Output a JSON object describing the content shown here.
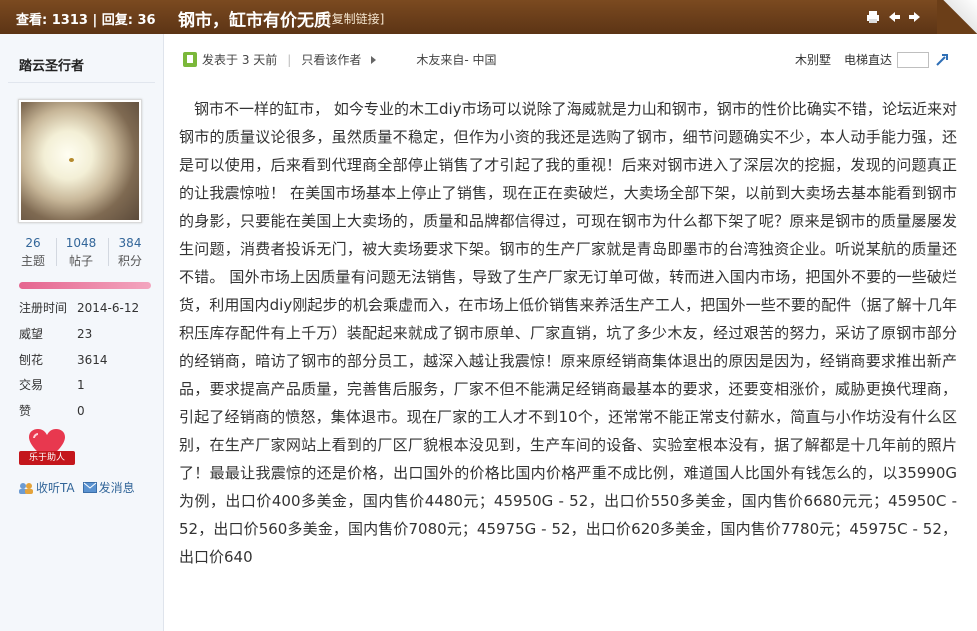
{
  "header": {
    "views_label": "查看:",
    "views": "1313",
    "replies_label": "回复:",
    "replies": "36",
    "title": "钢市，缸市有价无质",
    "copy_link": "[复制链接]"
  },
  "author": {
    "name": "踏云圣行者",
    "stats": [
      {
        "value": "26",
        "label": "主题"
      },
      {
        "value": "1048",
        "label": "帖子"
      },
      {
        "value": "384",
        "label": "积分"
      }
    ],
    "info": [
      {
        "key": "注册时间",
        "value": "2014-6-12"
      },
      {
        "key": "威望",
        "value": "23"
      },
      {
        "key": "刨花",
        "value": "3614"
      },
      {
        "key": "交易",
        "value": "1"
      },
      {
        "key": "赞",
        "value": "0"
      }
    ],
    "badge": "乐于助人",
    "follow": "收听TA",
    "message": "发消息"
  },
  "post": {
    "posted": "发表于 3 天前",
    "only_author": "只看该作者",
    "source": "木友来自- 中国",
    "floor": "木别墅",
    "elevator": "电梯直达",
    "body": "钢市不一样的缸市， 如今专业的木工diy市场可以说除了海威就是力山和钢市，钢市的性价比确实不错，论坛近来对钢市的质量议论很多，虽然质量不稳定，但作为小资的我还是选购了钢市，细节问题确实不少，本人动手能力强，还是可以使用，后来看到代理商全部停止销售了才引起了我的重视！后来对钢市进入了深层次的挖掘，发现的问题真正的让我震惊啦！ 在美国市场基本上停止了销售，现在正在卖破烂，大卖场全部下架，以前到大卖场去基本能看到钢市的身影，只要能在美国上大卖场的，质量和品牌都信得过，可现在钢市为什么都下架了呢？原来是钢市的质量屡屡发生问题，消费者投诉无门，被大卖场要求下架。钢市的生产厂家就是青岛即墨市的台湾独资企业。听说某航的质量还不错。 国外市场上因质量有问题无法销售，导致了生产厂家无订单可做，转而进入国内市场，把国外不要的一些破烂货，利用国内diy刚起步的机会乘虚而入，在市场上低价销售来养活生产工人，把国外一些不要的配件（据了解十几年积压库存配件有上千万）装配起来就成了钢市原单、厂家直销，坑了多少木友，经过艰苦的努力，采访了原钢市部分的经销商，暗访了钢市的部分员工，越深入越让我震惊！原来原经销商集体退出的原因是因为，经销商要求推出新产品，要求提高产品质量，完善售后服务，厂家不但不能满足经销商最基本的要求，还要变相涨价，威胁更换代理商，引起了经销商的愤怒，集体退市。现在厂家的工人才不到10个，还常常不能正常支付薪水，简直与小作坊没有什么区别，在生产厂家网站上看到的厂区厂貌根本没见到，生产车间的设备、实验室根本没有，据了解都是十几年前的照片了！最最让我震惊的还是价格，出口国外的价格比国内价格严重不成比例，难道国人比国外有钱怎么的，以35990G为例，出口价400多美金，国内售价4480元；45950G - 52，出口价550多美金，国内售价6680元元；45950C - 52，出口价560多美金，国内售价7080元；45975G - 52，出口价620多美金，国内售价7780元；45975C - 52，出口价640"
  },
  "colors": {
    "header_bg": "#6b3e18",
    "link": "#336699",
    "level_bar": "#ec7fa2"
  }
}
